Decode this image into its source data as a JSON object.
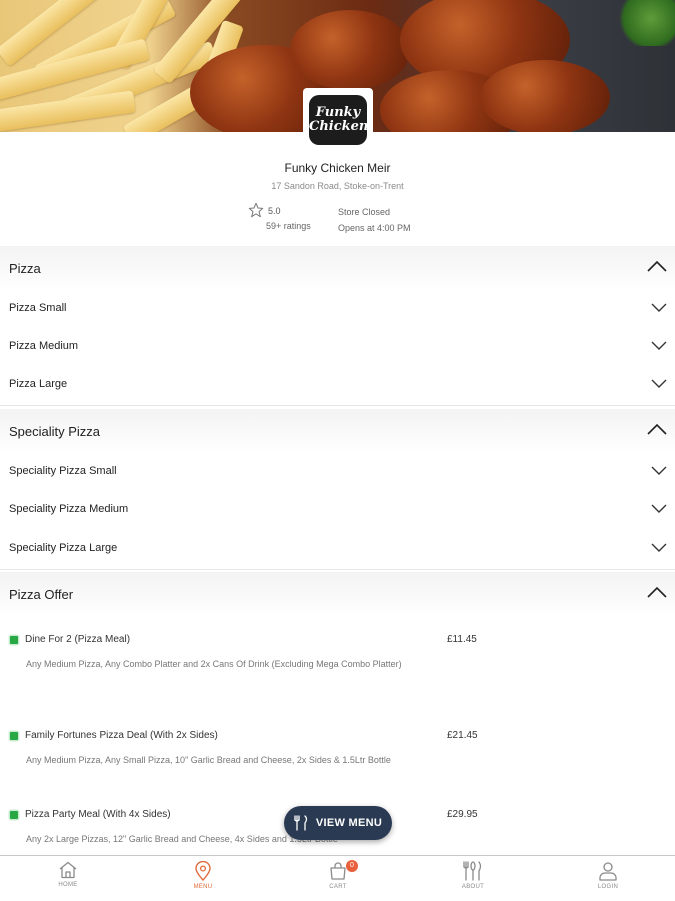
{
  "store": {
    "logo_text_line1": "Funky",
    "logo_text_line2": "Chicken",
    "name": "Funky Chicken Meir",
    "address": "17 Sandon Road, Stoke-on-Trent",
    "rating": "5.0",
    "ratings_count": "59+ ratings",
    "status": "Store Closed",
    "opens": "Opens at 4:00 PM"
  },
  "sections": [
    {
      "title": "Pizza",
      "items": [
        "Pizza Small",
        "Pizza Medium",
        "Pizza Large"
      ]
    },
    {
      "title": "Speciality Pizza",
      "items": [
        "Speciality Pizza Small",
        "Speciality Pizza Medium",
        "Speciality Pizza Large"
      ]
    },
    {
      "title": "Pizza Offer"
    }
  ],
  "offers": [
    {
      "name": "Dine For 2 (Pizza Meal)",
      "price": "£11.45",
      "desc": "Any Medium Pizza, Any Combo Platter and 2x Cans Of Drink (Excluding Mega Combo Platter)"
    },
    {
      "name": "Family Fortunes Pizza Deal (With 2x Sides)",
      "price": "£21.45",
      "desc": "Any Medium Pizza, Any Small Pizza, 10\" Garlic Bread and Cheese, 2x Sides & 1.5Ltr Bottle"
    },
    {
      "name": "Pizza Party Meal (With 4x Sides)",
      "price": "£29.95",
      "desc": "Any 2x Large Pizzas, 12\" Garlic Bread and Cheese, 4x Sides and 1.5Ltr Bottle"
    }
  ],
  "view_menu_label": "VIEW MENU",
  "nav": {
    "home": "HOME",
    "menu": "MENU",
    "cart": "CART",
    "cart_count": "0",
    "about": "ABOUT",
    "login": "LOGIN"
  },
  "colors": {
    "accent": "#e06b3a",
    "fab": "#2a3a52",
    "veg_mark": "#27a844",
    "badge": "#e8603c"
  }
}
